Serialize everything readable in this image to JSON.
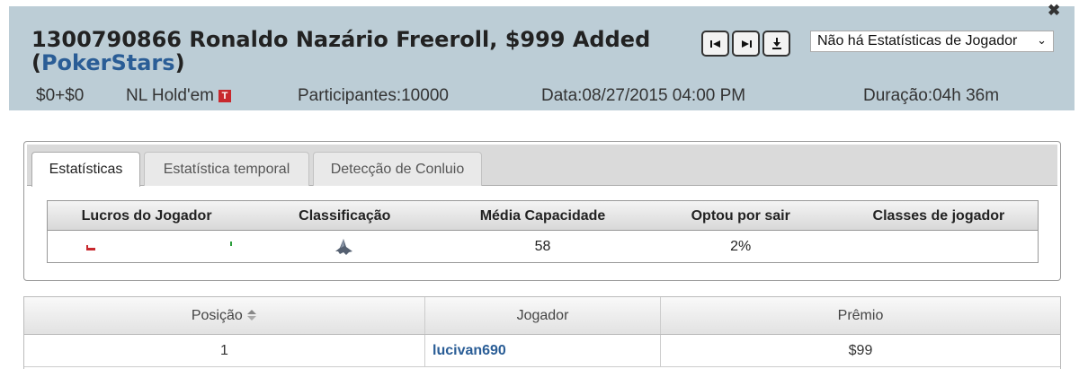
{
  "header": {
    "title_prefix": "1300790866 Ronaldo Nazário Freeroll, $999 Added",
    "site_open": "(",
    "site": "PokerStars",
    "site_close": ")",
    "nav": {
      "first_icon": "skip-to-start-icon",
      "next_icon": "skip-to-end-icon",
      "download_icon": "download-icon"
    },
    "stats_select": "Não há Estatísticas de Jogador",
    "close_icon": "close-icon",
    "buyin": "$0+$0",
    "game": "NL Hold'em",
    "badge": "T",
    "participants": "Participantes:10000",
    "date": "Data:08/27/2015 04:00 PM",
    "duration": "Duração:04h 36m"
  },
  "tabs": [
    {
      "label": "Estatísticas",
      "active": true
    },
    {
      "label": "Estatística temporal",
      "active": false
    },
    {
      "label": "Detecção de Conluio",
      "active": false
    }
  ],
  "stats": {
    "headers": [
      "Lucros do Jogador",
      "Classificação",
      "Média Capacidade",
      "Optou por sair",
      "Classes de jogador"
    ],
    "classification_icon": "shark-icon",
    "average_capacity": "58",
    "opted_out": "2%",
    "player_classes": ""
  },
  "results": {
    "headers": {
      "position": "Posição",
      "player": "Jogador",
      "prize": "Prêmio"
    },
    "sort_icon": "sort-arrows-icon",
    "rows": [
      {
        "position": "1",
        "player": "lucivan690",
        "prize": "$99"
      }
    ]
  },
  "colors": {
    "header_bg": "#bccdd6",
    "link": "#2a5d96",
    "badge": "#c8282d",
    "loss_bar": "#c8282d",
    "win_bar": "#2a9d3a"
  }
}
